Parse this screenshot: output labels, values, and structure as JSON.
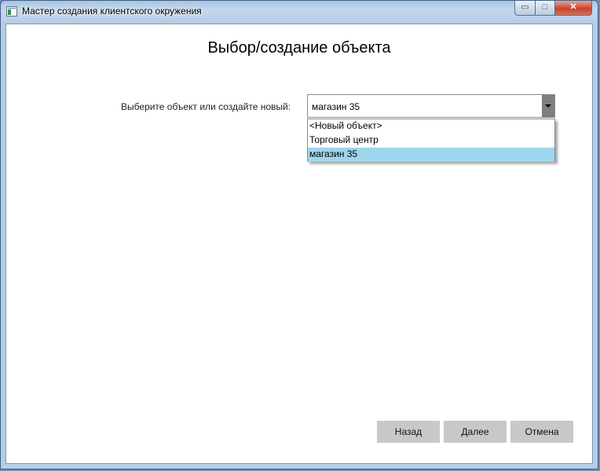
{
  "window": {
    "title": "Мастер создания клиентского окружения",
    "controls": {
      "minimize": "▭",
      "maximize": "□",
      "close": "✕"
    }
  },
  "page": {
    "title": "Выбор/создание объекта",
    "select_label": "Выберите объект или создайте новый:",
    "select_value": "магазин 35",
    "options": [
      "<Новый объект>",
      "Торговый центр",
      "магазин 35"
    ],
    "selected_option": "магазин 35"
  },
  "footer": {
    "back": "Назад",
    "next": "Далее",
    "cancel": "Отмена"
  },
  "colors": {
    "selection": "#9ed6ee",
    "button": "#c8c8c8",
    "combo_arrow": "#7f7f7f"
  }
}
